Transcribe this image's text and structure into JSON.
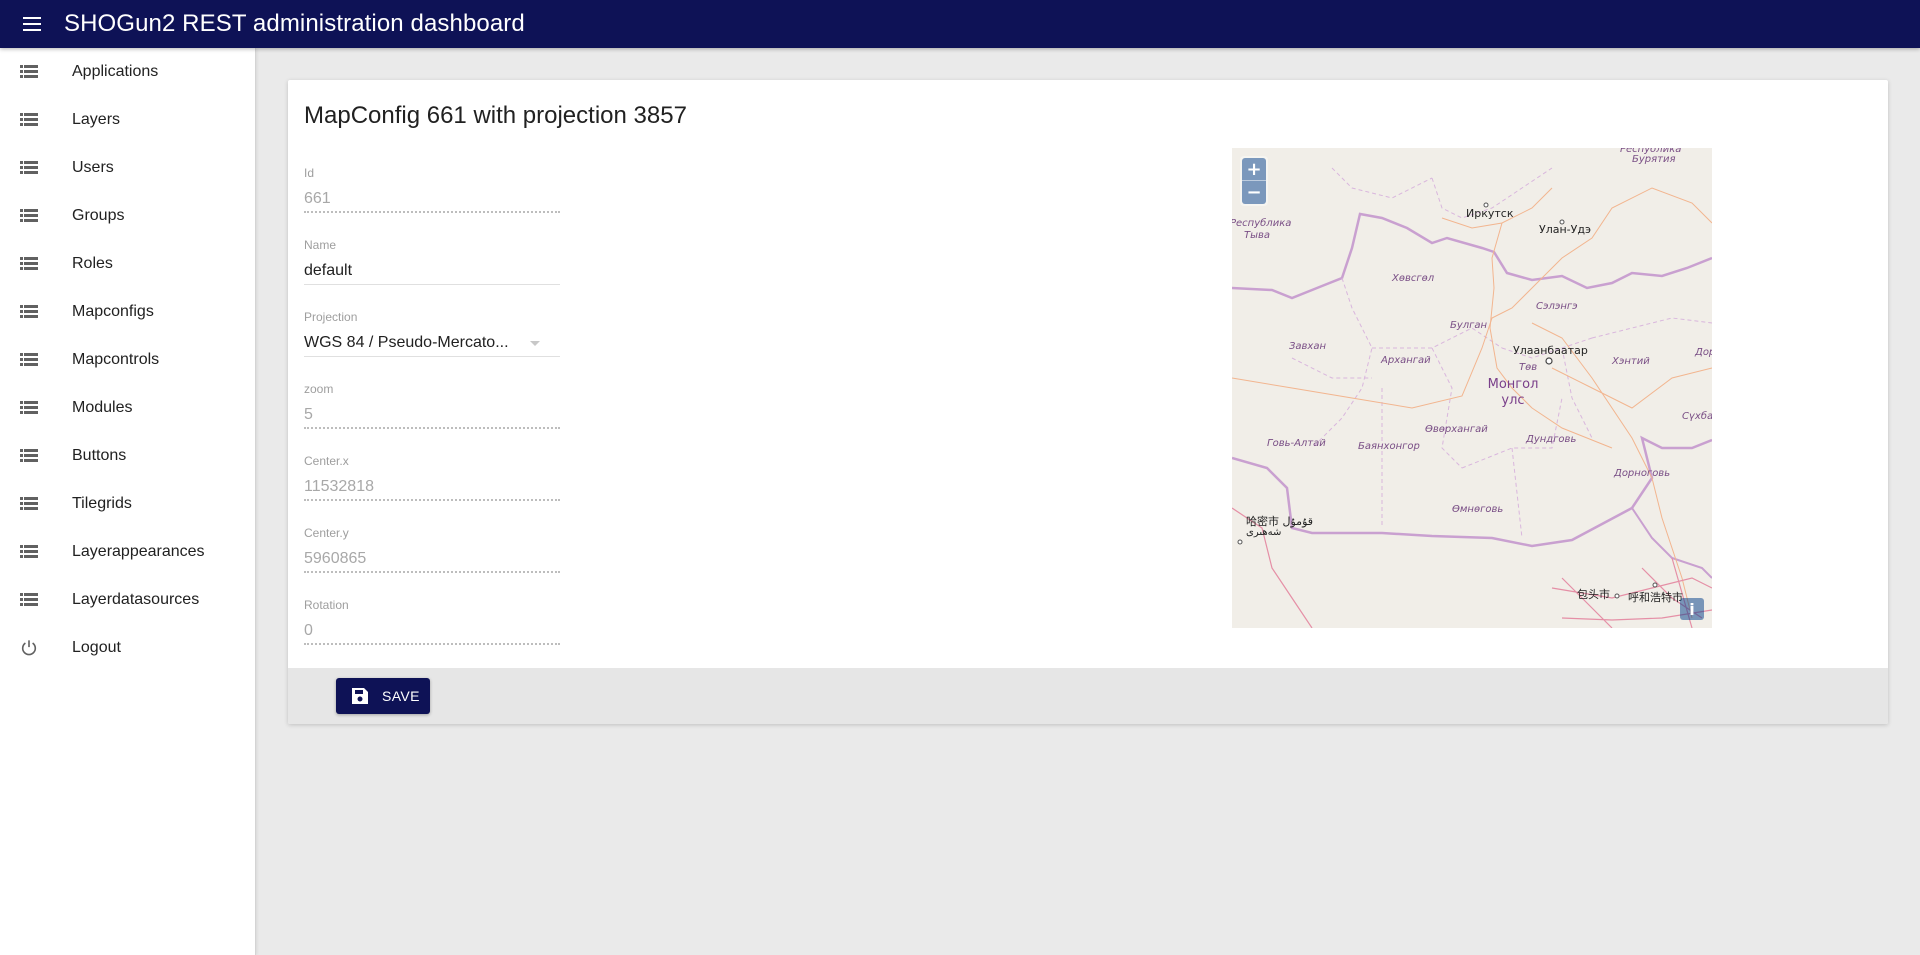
{
  "appbar": {
    "title": "SHOGun2 REST administration dashboard",
    "menu_icon": "hamburger-menu-icon",
    "background_color": "#0e1256"
  },
  "sidebar": {
    "items": [
      {
        "label": "Applications",
        "icon": "list-icon"
      },
      {
        "label": "Layers",
        "icon": "list-icon"
      },
      {
        "label": "Users",
        "icon": "list-icon"
      },
      {
        "label": "Groups",
        "icon": "list-icon"
      },
      {
        "label": "Roles",
        "icon": "list-icon"
      },
      {
        "label": "Mapconfigs",
        "icon": "list-icon"
      },
      {
        "label": "Mapcontrols",
        "icon": "list-icon"
      },
      {
        "label": "Modules",
        "icon": "list-icon"
      },
      {
        "label": "Buttons",
        "icon": "list-icon"
      },
      {
        "label": "Tilegrids",
        "icon": "list-icon"
      },
      {
        "label": "Layerappearances",
        "icon": "list-icon"
      },
      {
        "label": "Layerdatasources",
        "icon": "list-icon"
      },
      {
        "label": "Logout",
        "icon": "power-icon"
      }
    ]
  },
  "card": {
    "title": "MapConfig 661 with projection 3857",
    "fields": {
      "id": {
        "label": "Id",
        "value": "661",
        "disabled": true
      },
      "name": {
        "label": "Name",
        "value": "default",
        "disabled": false
      },
      "projection": {
        "label": "Projection",
        "value": "WGS 84 / Pseudo-Mercato...",
        "disabled": false
      },
      "zoom": {
        "label": "zoom",
        "value": "5",
        "disabled": true
      },
      "center_x": {
        "label": "Center.x",
        "value": "11532818",
        "disabled": true
      },
      "center_y": {
        "label": "Center.y",
        "value": "5960865",
        "disabled": true
      },
      "rotation": {
        "label": "Rotation",
        "value": "0",
        "disabled": true
      }
    },
    "save_label": "SAVE",
    "save_icon": "floppy-disk-icon"
  },
  "map": {
    "zoom_in": "+",
    "zoom_out": "−",
    "info": "i",
    "labels": {
      "buryatia_1": "Республика",
      "buryatia_2": "Бурятия",
      "irkutsk": "Иркутск",
      "ulan_ude": "Улан-Удэ",
      "tuva_1": "Республика",
      "tuva_2": "Тыва",
      "khovsgol": "Хөвсгөл",
      "bulgan": "Булган",
      "selenge": "Сэлэнгэ",
      "zavkhan": "Завхан",
      "arkhangai": "Архангай",
      "ulaanbaatar": "Улаанбаатар",
      "tov": "Төв",
      "khentii": "Хэнтий",
      "dornod": "Дорн",
      "mongolia_1": "Монгол",
      "mongolia_2": "улс",
      "sukhbaatar": "Сүхбаа",
      "gobi_altai": "Говь-Алтай",
      "bayankhongor": "Баянхонгор",
      "ovorkhangai": "Өвөрхангай",
      "dundgovi": "Дундговь",
      "dornogovi": "Дорноговь",
      "hami_1": "哈密市 قۇمۇل",
      "hami_2": "شەھىرى",
      "omnogovi": "Өмнөговь",
      "baotou": "包头市",
      "hohhot": "呼和浩特市"
    }
  }
}
